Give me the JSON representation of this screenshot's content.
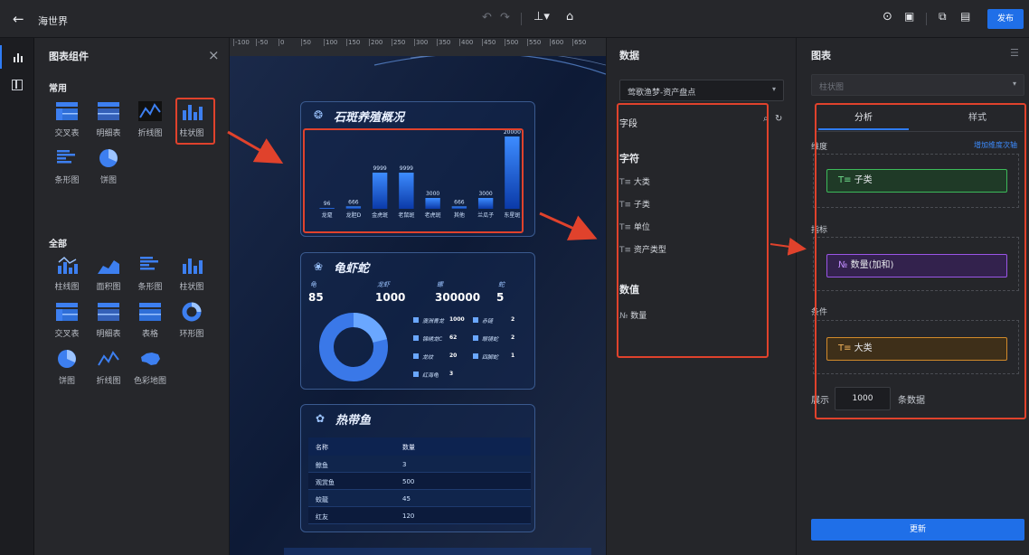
{
  "topbar": {
    "back_icon": "arrow-left-icon",
    "title": "海世界",
    "publish": "发布"
  },
  "library": {
    "title": "图表组件",
    "common_label": "常用",
    "all_label": "全部",
    "common": [
      {
        "label": "交叉表",
        "icon": "cross-table-icon"
      },
      {
        "label": "明细表",
        "icon": "detail-table-icon"
      },
      {
        "label": "折线图",
        "icon": "line-chart-icon"
      },
      {
        "label": "柱状图",
        "icon": "bar-chart-icon"
      },
      {
        "label": "条形图",
        "icon": "hbar-chart-icon"
      },
      {
        "label": "饼图",
        "icon": "pie-chart-icon"
      }
    ],
    "all": [
      {
        "label": "柱线图",
        "icon": "bar-line-icon"
      },
      {
        "label": "面积图",
        "icon": "area-chart-icon"
      },
      {
        "label": "条形图",
        "icon": "hbar-chart-icon"
      },
      {
        "label": "柱状图",
        "icon": "bar-chart-icon"
      },
      {
        "label": "交叉表",
        "icon": "cross-table-icon"
      },
      {
        "label": "明细表",
        "icon": "detail-table-icon"
      },
      {
        "label": "表格",
        "icon": "table-icon"
      },
      {
        "label": "环形图",
        "icon": "donut-icon"
      },
      {
        "label": "饼图",
        "icon": "pie-chart-icon"
      },
      {
        "label": "折线图",
        "icon": "line-chart-icon"
      },
      {
        "label": "色彩地图",
        "icon": "map-icon"
      }
    ]
  },
  "ruler": [
    "-100",
    "-50",
    "0",
    "50",
    "100",
    "150",
    "200",
    "250",
    "300",
    "350",
    "400",
    "450",
    "500",
    "550",
    "600",
    "650"
  ],
  "cards": {
    "card1": {
      "title": "石斑养殖概况",
      "chart_data": {
        "type": "bar",
        "categories": [
          "龙趸",
          "龙胆D",
          "金虎斑",
          "老鼠斑",
          "老虎斑",
          "其他",
          "兰瓜子",
          "东星斑"
        ],
        "values": [
          96,
          666,
          9999,
          9999,
          3000,
          666,
          3000,
          20000
        ],
        "ylim": [
          0,
          20000
        ]
      }
    },
    "card2": {
      "title": "龟虾蛇",
      "stats": [
        {
          "label": "龟",
          "value": "85"
        },
        {
          "label": "龙虾",
          "value": "1000"
        },
        {
          "label": "螺",
          "value": "300000"
        },
        {
          "label": "蛇",
          "value": "5"
        }
      ],
      "legend": [
        {
          "name": "澳洲青龙",
          "value": "1000"
        },
        {
          "name": "锦绣龙C",
          "value": "62"
        },
        {
          "name": "龙纹",
          "value": "20"
        },
        {
          "name": "红海龟",
          "value": "3"
        },
        {
          "name": "赤链",
          "value": "2"
        },
        {
          "name": "眼镜蛇",
          "value": "2"
        },
        {
          "name": "四脚蛇",
          "value": "1"
        }
      ]
    },
    "card3": {
      "title": "热带鱼",
      "headers": [
        "名称",
        "数量"
      ],
      "rows": [
        [
          "鲸鱼",
          "3"
        ],
        [
          "观赏鱼",
          "500"
        ],
        [
          "蛟龍",
          "45"
        ],
        [
          "红友",
          "120"
        ]
      ]
    }
  },
  "data_panel": {
    "title": "数据",
    "dataset": "莺歌渔梦-资产盘点",
    "fields_label": "字段",
    "char_label": "字符",
    "num_label": "数值",
    "char_fields": [
      "大类",
      "子类",
      "单位",
      "资产类型"
    ],
    "num_fields": [
      "数量"
    ]
  },
  "chart_panel": {
    "title": "图表",
    "type_select": "柱状图",
    "tabs": [
      "分析",
      "样式"
    ],
    "dimension_label": "维度",
    "add_dim": "增加维度次轴",
    "metric_label": "指标",
    "filter_label": "条件",
    "dimension_value": "子类",
    "metric_value": "数量(加和)",
    "filter_value": "大类",
    "show_label": "展示",
    "show_count": "1000",
    "show_suffix": "条数据",
    "update": "更新"
  }
}
